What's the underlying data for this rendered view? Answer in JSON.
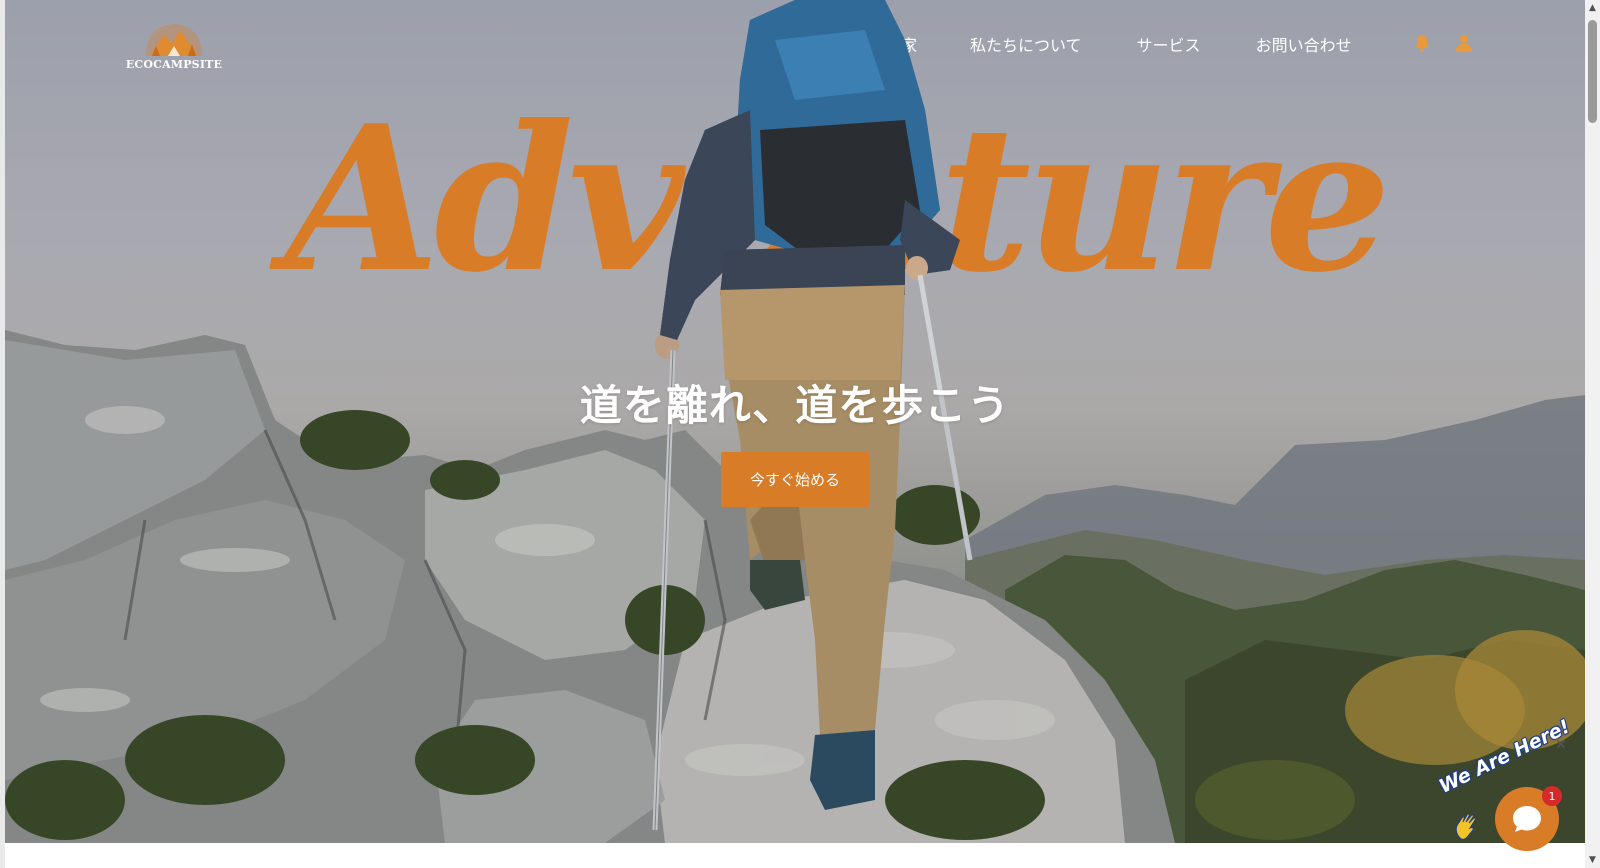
{
  "brand": {
    "name": "ECOCAMPSITE"
  },
  "nav": {
    "items": [
      {
        "label": "家"
      },
      {
        "label": "私たちについて"
      },
      {
        "label": "サービス"
      },
      {
        "label": "お問い合わせ"
      }
    ],
    "icons": [
      "bell-icon",
      "user-icon"
    ]
  },
  "hero": {
    "script_word": "Adventure",
    "headline": "道を離れ、道を歩こう",
    "cta_label": "今すぐ始める"
  },
  "chat": {
    "banner": "We Are Here!",
    "badge_count": "1",
    "hand_icon": "waving-hand-icon",
    "bubble_icon": "chat-bubble-icon"
  },
  "colors": {
    "accent": "#d97c27",
    "text_light": "#ffffff"
  }
}
